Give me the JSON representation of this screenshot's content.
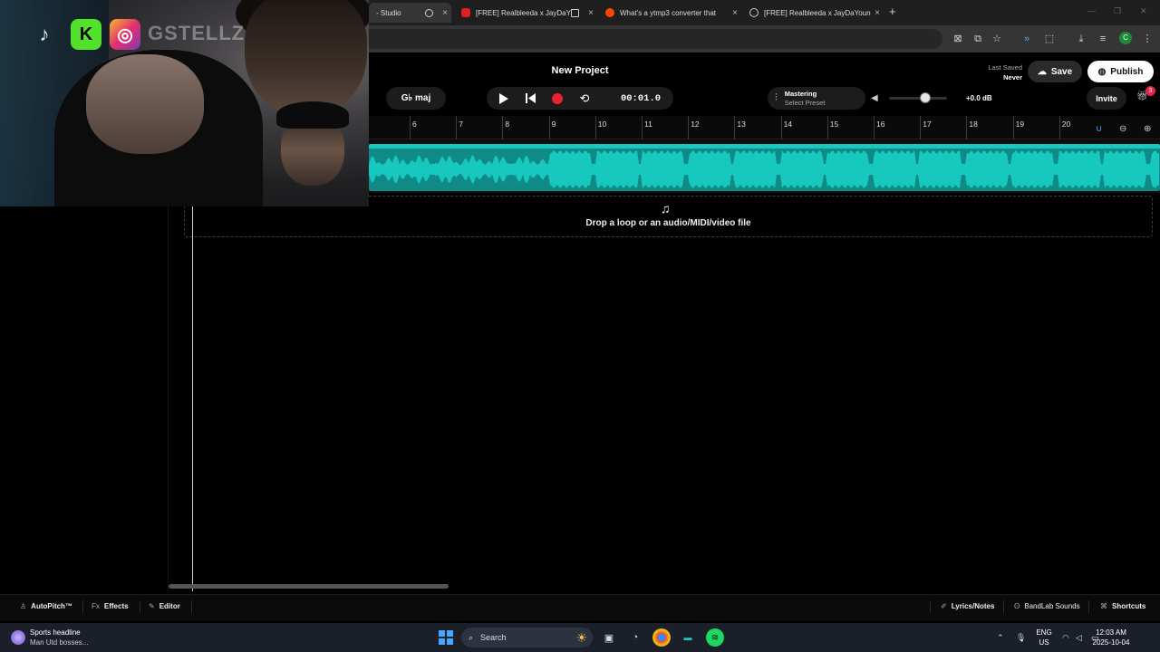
{
  "browser": {
    "tabs": [
      {
        "title": "- Studio",
        "close": "×"
      },
      {
        "title": "[FREE] Realbleeda x JayDaY",
        "close": "×"
      },
      {
        "title": "What's a ytmp3 converter that",
        "close": "×"
      },
      {
        "title": "[FREE] Realbleeda x JayDaYoung",
        "close": "×"
      }
    ],
    "new_tab": "+",
    "profile_initial": "C"
  },
  "webcam": {
    "handle": "GSTELLZ",
    "tiktok": "♪",
    "kick": "K",
    "instagram": "◎"
  },
  "studio": {
    "project_title": "New Project",
    "last_saved_label": "Last Saved",
    "last_saved_value": "Never",
    "save_label": "Save",
    "publish_label": "Publish",
    "key_label": "G♭ maj",
    "time": "00:01.0",
    "mastering_title": "Mastering",
    "mastering_preset": "Select Preset",
    "master_volume_db": "+0.0 dB",
    "master_volume_level": 0.62,
    "invite_label": "Invite",
    "gift_badge": "3",
    "ruler_numbers": [
      "6",
      "7",
      "8",
      "9",
      "10",
      "11",
      "12",
      "13",
      "14",
      "15",
      "16",
      "17",
      "18",
      "19",
      "20"
    ],
    "drop_zone_text": "Drop a loop or an audio/MIDI/video file",
    "region_color": "#16c8be"
  },
  "bottom_bar": {
    "autopitch": "AutoPitch™",
    "effects": "Effects",
    "editor": "Editor",
    "lyrics": "Lyrics/Notes",
    "sounds": "BandLab Sounds",
    "shortcuts": "Shortcuts"
  },
  "taskbar": {
    "news_title": "Sports headline",
    "news_sub": "Man Utd bosses...",
    "search_label": "Search",
    "lang_1": "ENG",
    "lang_2": "US",
    "time": "12:03 AM",
    "date": "2025-10-04"
  }
}
